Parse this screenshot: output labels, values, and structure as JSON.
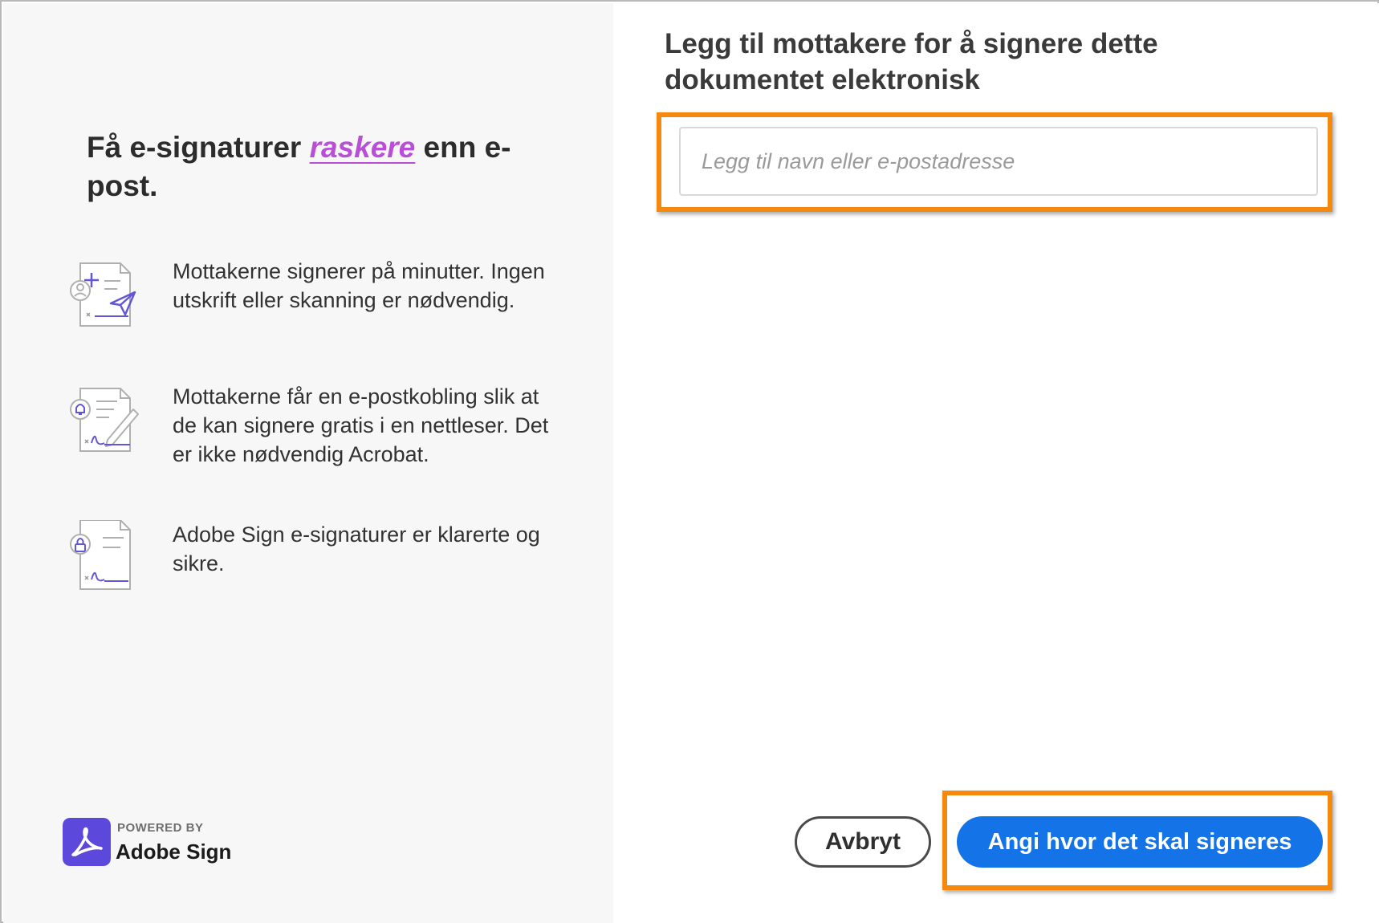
{
  "left": {
    "headline_before": "Få e-signaturer",
    "headline_accent": "raskere",
    "headline_after": "enn e-post.",
    "features": [
      {
        "icon": "send-document-icon",
        "text": "Mottakerne signerer på minutter. Ingen utskrift eller skanning er nødvendig."
      },
      {
        "icon": "notify-sign-document-icon",
        "text": "Mottakerne får en e-postkobling slik at de kan signere gratis i en nettleser. Det er ikke nødvendig Acrobat."
      },
      {
        "icon": "secure-document-icon",
        "text": "Adobe Sign e-signaturer er klarerte og sikre."
      }
    ],
    "branding": {
      "powered_by": "POWERED BY",
      "product": "Adobe Sign"
    }
  },
  "right": {
    "title": "Legg til mottakere for å signere dette dokumentet elektronisk",
    "recipient_input": {
      "value": "",
      "placeholder": "Legg til navn eller e-postadresse"
    },
    "cancel_label": "Avbryt",
    "primary_label": "Angi hvor det skal signeres"
  },
  "colors": {
    "accent_purple": "#b84fd6",
    "primary_blue": "#1473e6",
    "highlight_orange": "#f5890f",
    "icon_purple": "#6457d6",
    "brand_purple": "#5c49dc"
  }
}
